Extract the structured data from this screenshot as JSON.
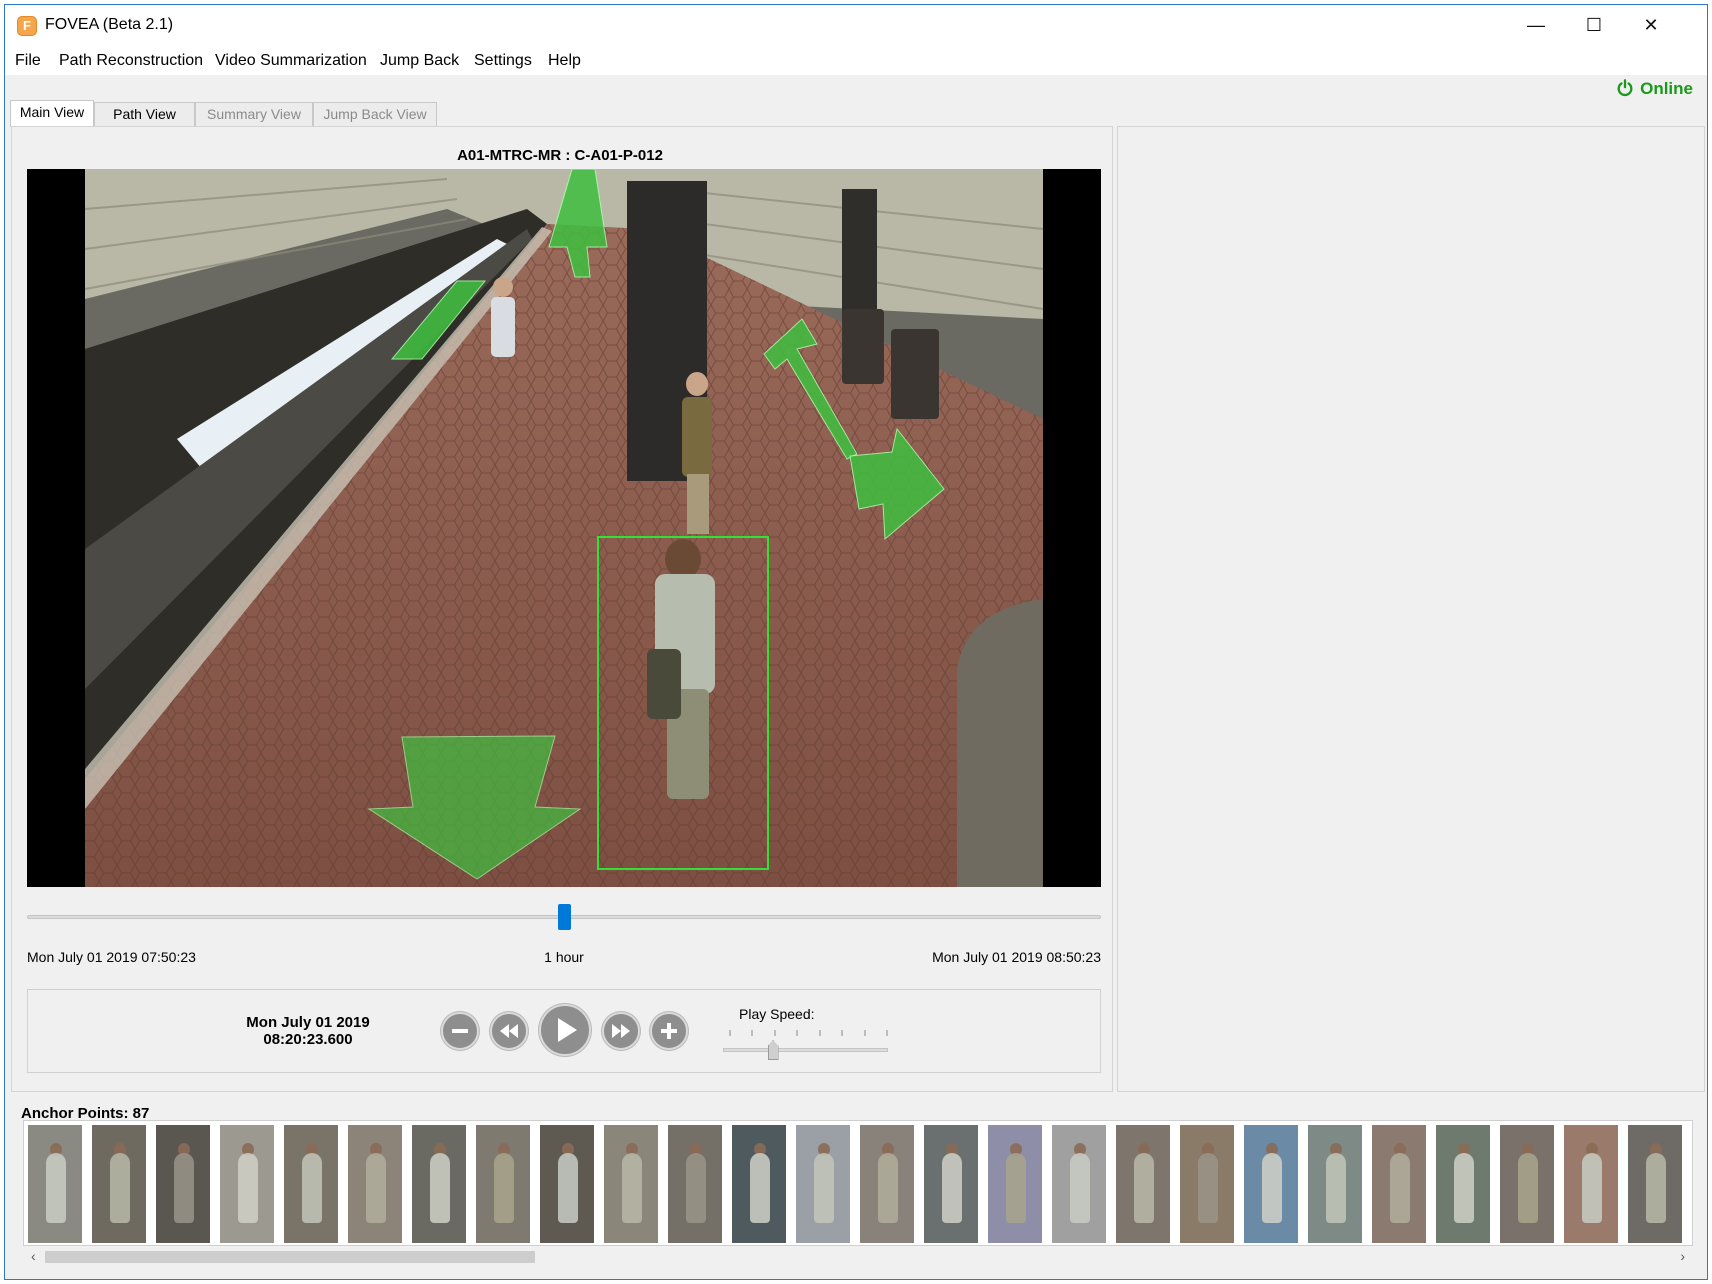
{
  "window": {
    "title": "FOVEA (Beta 2.1)",
    "app_icon_letter": "F",
    "controls": {
      "minimize": "—",
      "maximize": "☐",
      "close": "✕"
    }
  },
  "menu": {
    "items": [
      "File",
      "Path Reconstruction",
      "Video Summarization",
      "Jump Back",
      "Settings",
      "Help"
    ]
  },
  "status": {
    "label": "Online",
    "color": "#1a9a1a"
  },
  "tabs": [
    {
      "label": "Main View",
      "state": "active"
    },
    {
      "label": "Path View",
      "state": "normal"
    },
    {
      "label": "Summary View",
      "state": "disabled"
    },
    {
      "label": "Jump Back View",
      "state": "disabled"
    }
  ],
  "camera": {
    "title": "A01-MTRC-MR : C-A01-P-012"
  },
  "timeline": {
    "start": "Mon July 01 2019 07:50:23",
    "span": "1 hour",
    "end": "Mon July 01 2019 08:50:23",
    "position_fraction": 0.5
  },
  "playback": {
    "current_date": "Mon July 01 2019",
    "current_time": "08:20:23.600",
    "speed_label": "Play Speed:",
    "speed_level": 0.3,
    "controls": [
      "zoom-out",
      "rewind",
      "play",
      "fast-forward",
      "zoom-in"
    ]
  },
  "anchors": {
    "label": "Anchor Points: 87",
    "visible_thumbnails": 26
  },
  "colors": {
    "accent": "#0078d7",
    "overlay_green": "#3fbf3f",
    "tile_floor": "#8a5a4a"
  }
}
